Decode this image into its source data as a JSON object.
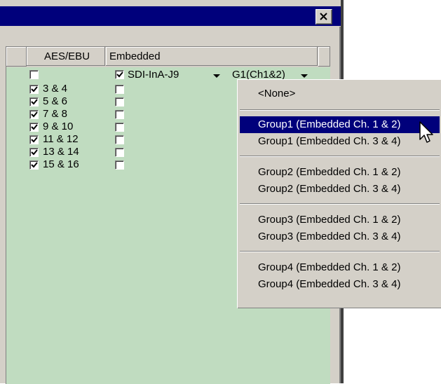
{
  "window": {
    "close_icon": "close-icon"
  },
  "columns": {
    "aes_ebu": "AES/EBU",
    "embedded": "Embedded"
  },
  "rows": [
    {
      "aes_checked": false,
      "aes_label": "",
      "emb_checked": true,
      "emb_source": "SDI-InA-J9",
      "emb_group": "G1(Ch1&2)"
    },
    {
      "aes_checked": true,
      "aes_label": "3 & 4",
      "emb_checked": false
    },
    {
      "aes_checked": true,
      "aes_label": "5 & 6",
      "emb_checked": false
    },
    {
      "aes_checked": true,
      "aes_label": "7 & 8",
      "emb_checked": false
    },
    {
      "aes_checked": true,
      "aes_label": "9 & 10",
      "emb_checked": false
    },
    {
      "aes_checked": true,
      "aes_label": "11 & 12",
      "emb_checked": false
    },
    {
      "aes_checked": true,
      "aes_label": "13 & 14",
      "emb_checked": false
    },
    {
      "aes_checked": true,
      "aes_label": "15 & 16",
      "emb_checked": false
    }
  ],
  "menu": {
    "items": [
      {
        "label": "<None>"
      },
      {
        "label": "Group1 (Embedded Ch. 1 & 2)",
        "selected": true
      },
      {
        "label": "Group1 (Embedded Ch. 3 & 4)"
      },
      {
        "label": "Group2 (Embedded Ch. 1 & 2)"
      },
      {
        "label": "Group2 (Embedded Ch. 3 & 4)"
      },
      {
        "label": "Group3 (Embedded Ch. 1 & 2)"
      },
      {
        "label": "Group3 (Embedded Ch. 3 & 4)"
      },
      {
        "label": "Group4 (Embedded Ch. 1 & 2)"
      },
      {
        "label": "Group4 (Embedded Ch. 3 & 4)"
      }
    ]
  },
  "colors": {
    "title_bar": "#00007b",
    "list_bg": "#c0dcc0",
    "dialog_bg": "#d4d0c8",
    "selection": "#00007b"
  }
}
